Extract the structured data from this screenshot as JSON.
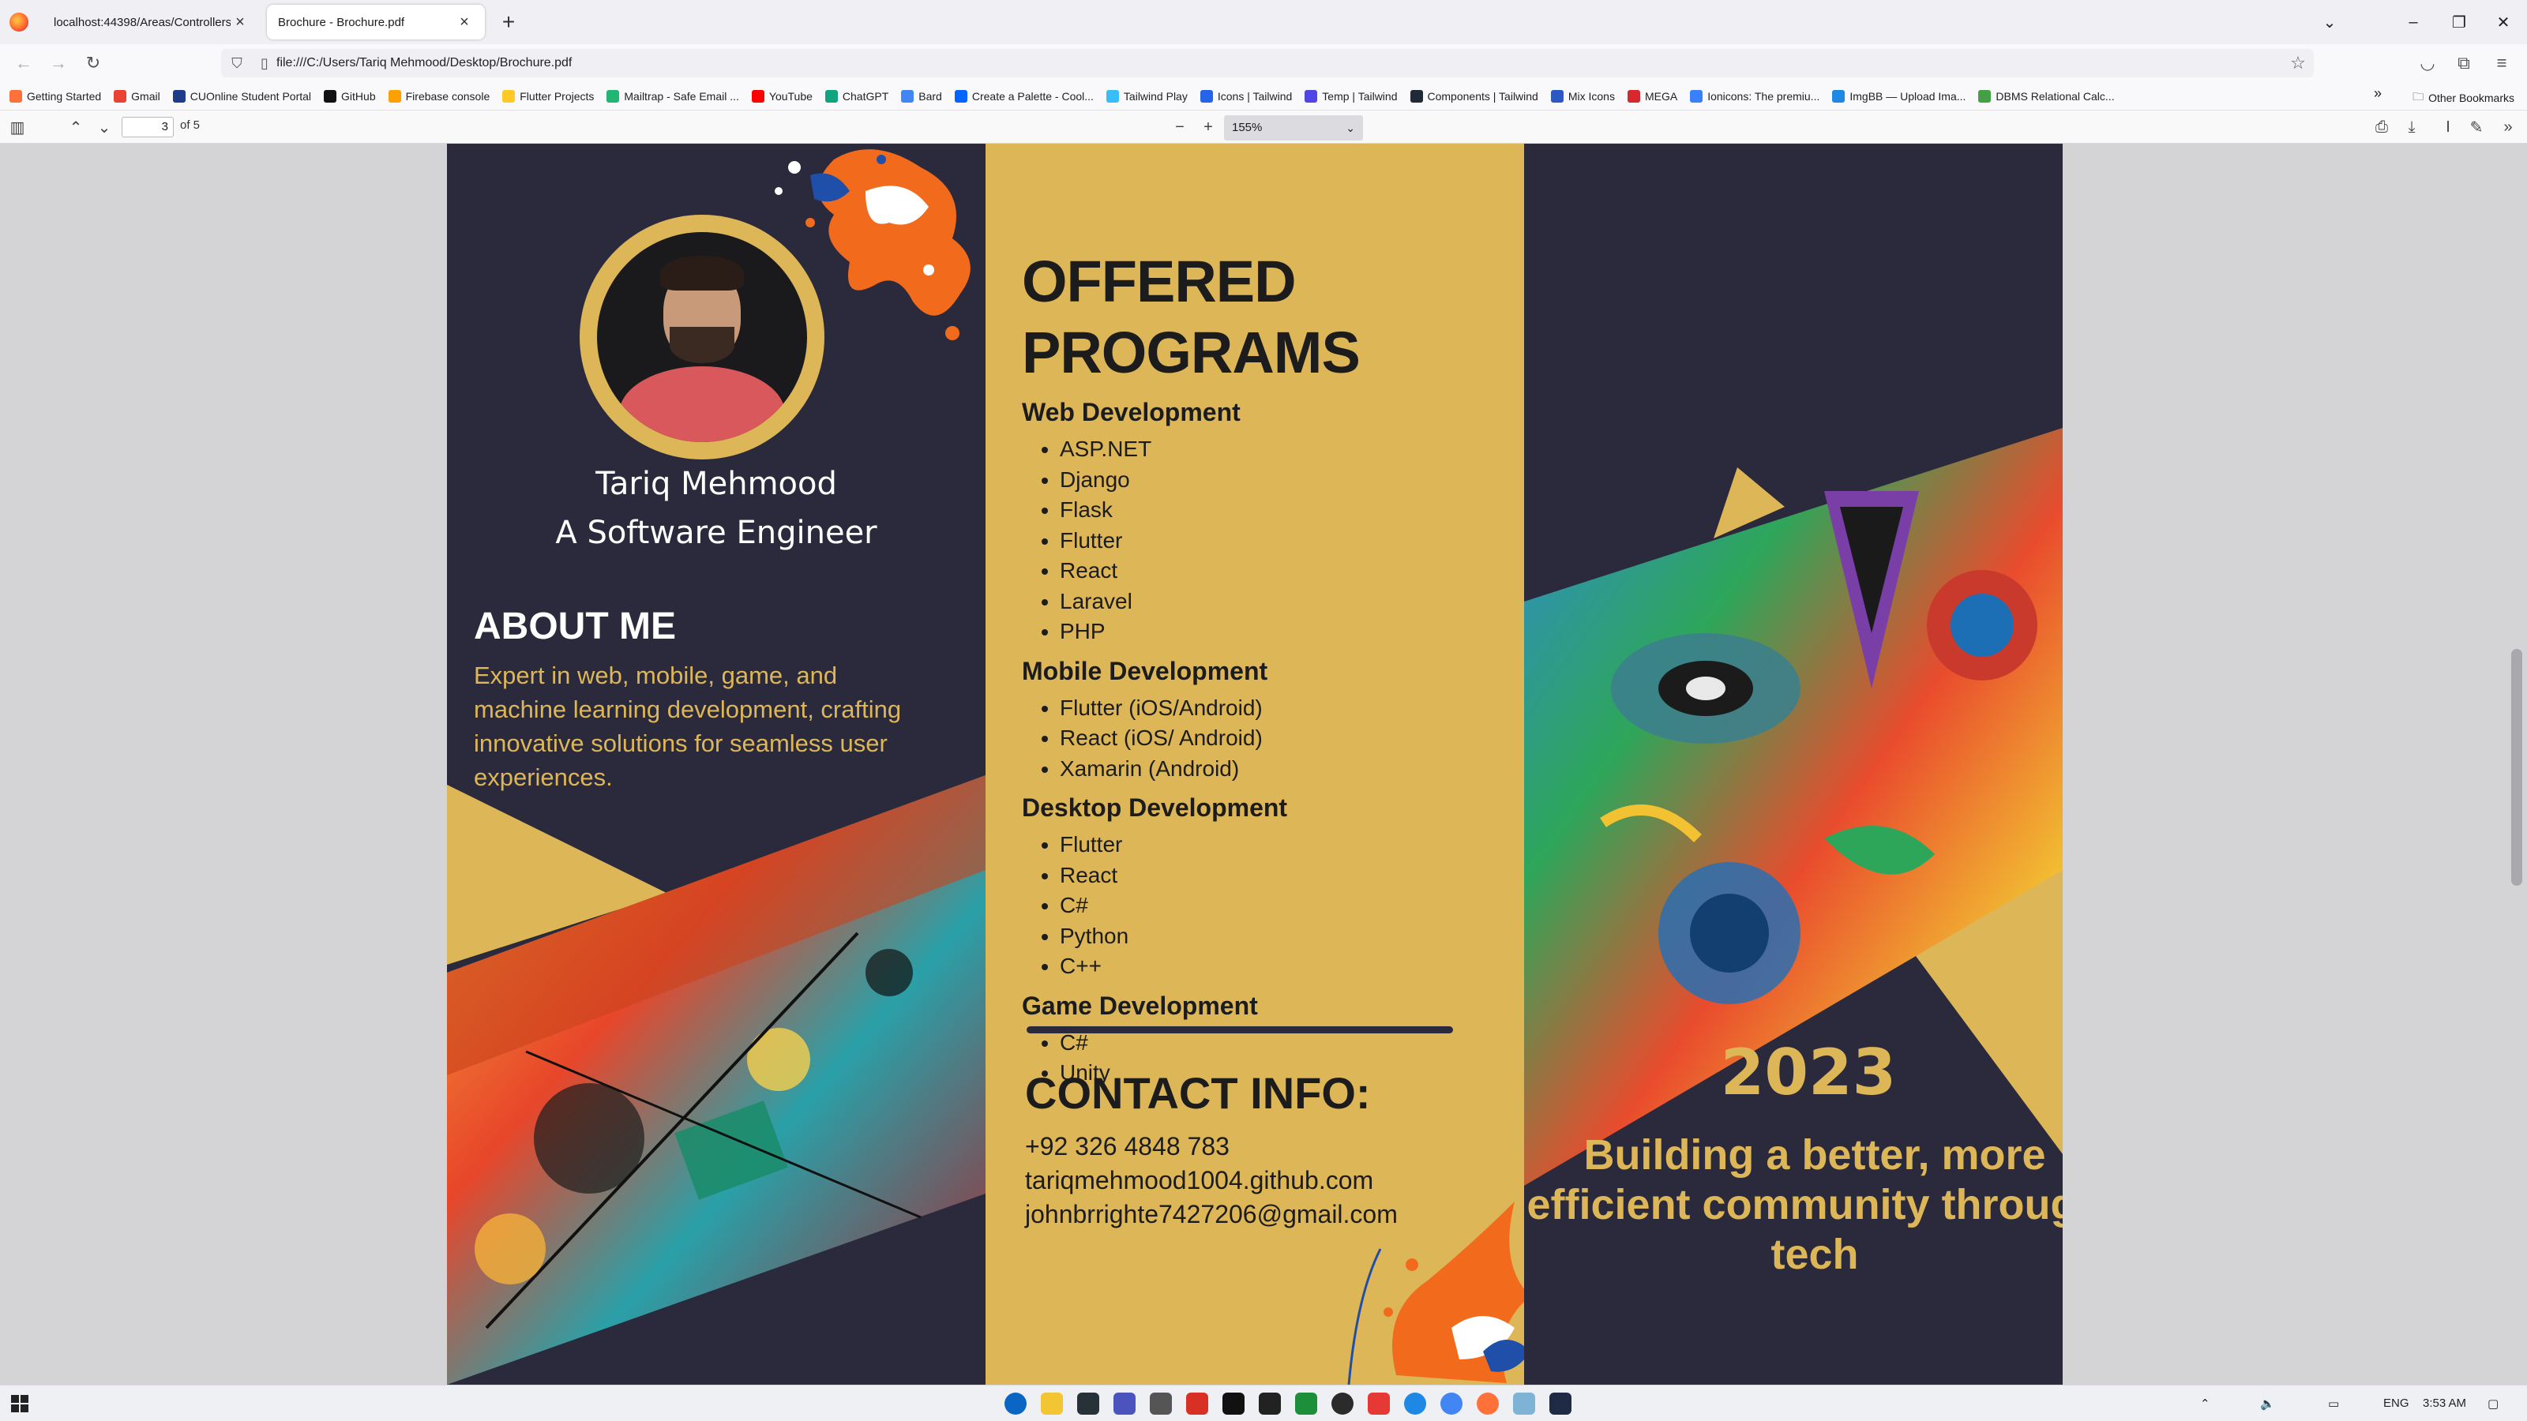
{
  "browser": {
    "tabs": [
      {
        "title": "localhost:44398/Areas/Controllers/..."
      },
      {
        "title": "Brochure - Brochure.pdf"
      }
    ],
    "url": "file:///C:/Users/Tariq Mehmood/Desktop/Brochure.pdf",
    "bookmarks": [
      {
        "label": "Getting Started",
        "color": "#ff7139"
      },
      {
        "label": "Gmail",
        "color": "#ea4335"
      },
      {
        "label": "CUOnline Student Portal",
        "color": "#1f3c88"
      },
      {
        "label": "GitHub",
        "color": "#111111"
      },
      {
        "label": "Firebase console",
        "color": "#ffa000"
      },
      {
        "label": "Flutter Projects",
        "color": "#ffca28"
      },
      {
        "label": "Mailtrap - Safe Email ...",
        "color": "#22b573"
      },
      {
        "label": "YouTube",
        "color": "#ff0000"
      },
      {
        "label": "ChatGPT",
        "color": "#10a37f"
      },
      {
        "label": "Bard",
        "color": "#4285f4"
      },
      {
        "label": "Create a Palette - Cool...",
        "color": "#0066ff"
      },
      {
        "label": "Tailwind Play",
        "color": "#38bdf8"
      },
      {
        "label": "Icons | Tailwind",
        "color": "#2563eb"
      },
      {
        "label": "Temp | Tailwind",
        "color": "#4f46e5"
      },
      {
        "label": "Components | Tailwind",
        "color": "#1f2937"
      },
      {
        "label": "Mix Icons",
        "color": "#2b59c3"
      },
      {
        "label": "MEGA",
        "color": "#d9272e"
      },
      {
        "label": "Ionicons: The premiu...",
        "color": "#3880ff"
      },
      {
        "label": "ImgBB — Upload Ima...",
        "color": "#1e88e5"
      },
      {
        "label": "DBMS Relational Calc...",
        "color": "#43a047"
      }
    ],
    "other_bookmarks": "Other Bookmarks"
  },
  "pdf_toolbar": {
    "page_current": "3",
    "page_total": "of 5",
    "zoom": "155%"
  },
  "brochure": {
    "name": "Tariq Mehmood",
    "role": "A Software Engineer",
    "about_title": "ABOUT ME",
    "about_text": "Expert in web, mobile, game, and machine learning development, crafting innovative solutions for seamless user experiences.",
    "programs_title": "OFFERED PROGRAMS",
    "categories": [
      {
        "title": "Web Development",
        "items": [
          "ASP.NET",
          "Django",
          "Flask",
          "Flutter",
          "React",
          "Laravel",
          "PHP"
        ]
      },
      {
        "title": "Mobile Development",
        "items": [
          "Flutter (iOS/Android)",
          "React (iOS/ Android)",
          "Xamarin (Android)"
        ]
      },
      {
        "title": "Desktop Development",
        "items": [
          "Flutter",
          "React",
          "C#",
          "Python",
          "C++"
        ]
      },
      {
        "title": "Game Development",
        "items": [
          "C#",
          "Unity"
        ]
      }
    ],
    "contact_title": "CONTACT INFO:",
    "contact": {
      "phone": "+92 326 4848 783",
      "github": "tariqmehmood1004.github.com",
      "email": "johnbrrighte7427206@gmail.com"
    },
    "year": "2023",
    "tagline": "Building a better, more efficient community through tech",
    "colors": {
      "navy": "#2b2a3d",
      "gold": "#ddb658"
    }
  },
  "taskbar": {
    "language": "ENG",
    "time": "3:53 AM"
  }
}
